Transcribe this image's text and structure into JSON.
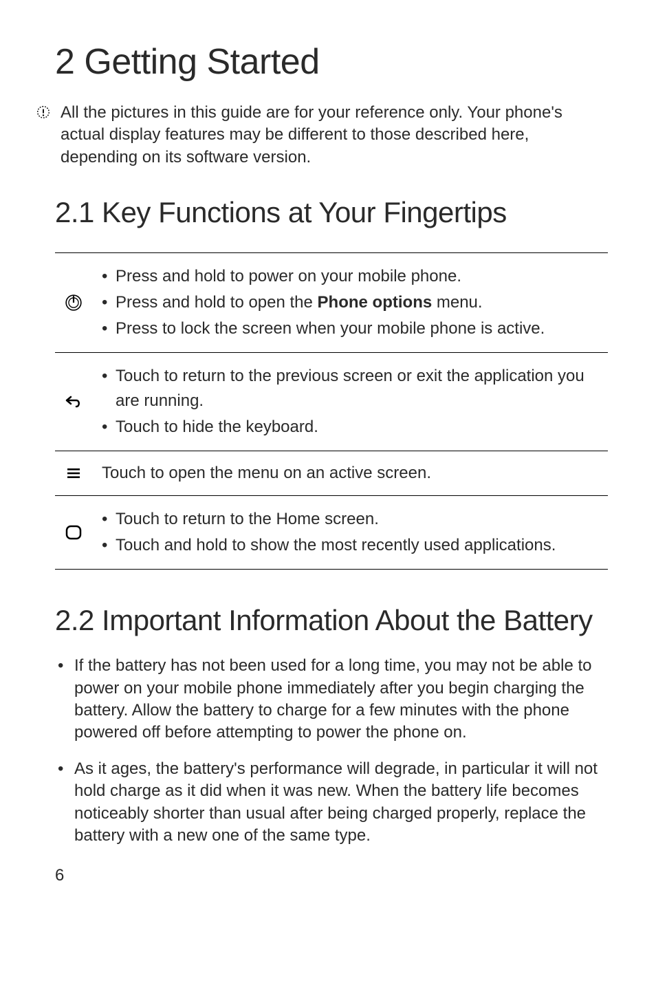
{
  "title": "2  Getting Started",
  "note": "All the pictures in this guide are for your reference only. Your phone's actual display features may be different to those described here, depending on its software version.",
  "section1": {
    "heading": "2.1  Key Functions at Your Fingertips",
    "rows": {
      "power": {
        "l1": "Press and hold to power on your mobile phone.",
        "l2a": "Press and hold to open the ",
        "l2b": "Phone options",
        "l2c": " menu.",
        "l3": "Press to lock the screen when your mobile phone is active."
      },
      "back": {
        "l1": "Touch to return to the previous screen or exit the application you are running.",
        "l2": "Touch to hide the keyboard."
      },
      "menu": {
        "l1": "Touch to open the menu on an active screen."
      },
      "home": {
        "l1": "Touch to return to the Home screen.",
        "l2": "Touch and hold to show the most recently used applications."
      }
    }
  },
  "section2": {
    "heading": "2.2  Important Information About the Battery",
    "items": {
      "i1": "If the battery has not been used for a long time, you may not be able to power on your mobile phone immediately after you begin charging the battery. Allow the battery to charge for a few minutes with the phone powered off before attempting to power the phone on.",
      "i2": "As it ages, the battery's performance will degrade, in particular it will not hold charge as it did when it was new. When the battery life becomes noticeably shorter than usual after being charged properly, replace the battery with a new one of the same type."
    }
  },
  "page": "6"
}
